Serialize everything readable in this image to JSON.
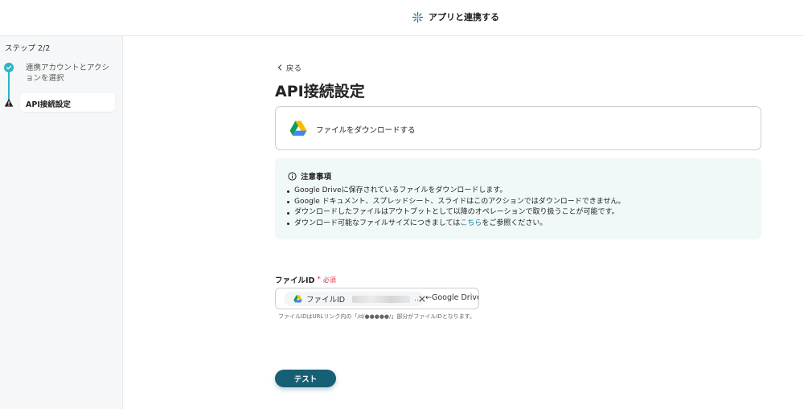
{
  "header": {
    "title": "アプリと連携する",
    "icon": "sparkle-icon"
  },
  "sidebar": {
    "step_indicator": "ステップ 2/2",
    "steps": [
      {
        "label": "連携アカウントとアクションを選択",
        "status": "completed"
      },
      {
        "label": "API接続設定",
        "status": "warning"
      }
    ]
  },
  "main": {
    "back_label": "戻る",
    "page_title": "API接続設定",
    "action": {
      "label": "ファイルをダウンロードする",
      "icon": "google-drive-icon"
    },
    "notes": {
      "title": "注意事項",
      "items": [
        "Google Driveに保存されているファイルをダウンロードします。",
        "Google ドキュメント、スプレッドシート、スライドはこのアクションではダウンロードできません。",
        "ダウンロードしたファイルはアウトプットとして以降のオペレーションで取り扱うことが可能です。"
      ],
      "last_item_prefix": "ダウンロード可能なファイルサイズにつきましては",
      "last_item_link": "こちら",
      "last_item_suffix": "をご参照ください。"
    },
    "field": {
      "label": "ファイルID",
      "required_mark": "*",
      "required_text": "必須",
      "chip_label": "ファイルID",
      "chip_ellipsis": "...",
      "suffix_text": "←Google Drive",
      "hint": "ファイルIDはURLリンク内の「/d/●●●●●/」部分がファイルIDとなります。"
    },
    "test_button": "テスト"
  },
  "colors": {
    "accent": "#2cb5c6",
    "primary_button": "#175f74",
    "required": "#e0334b",
    "link": "#1d7a9b",
    "notes_bg": "#f1f8f8"
  }
}
